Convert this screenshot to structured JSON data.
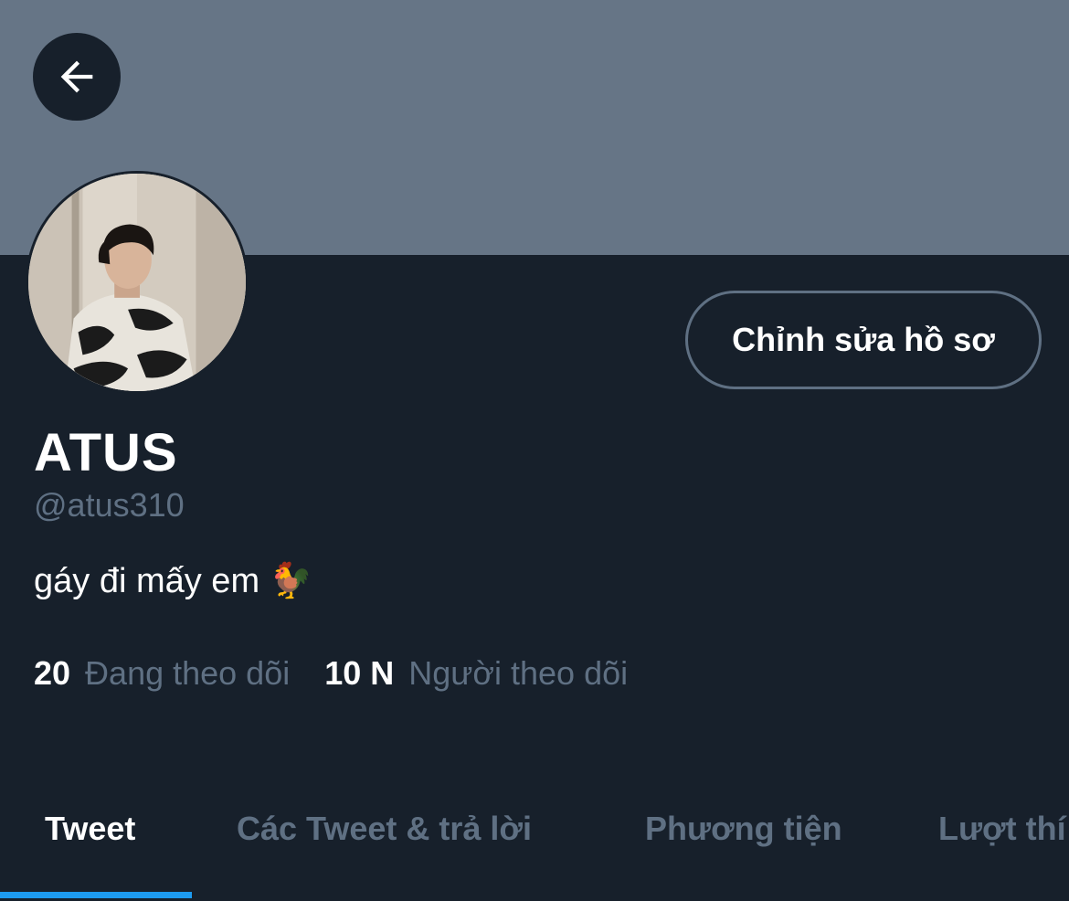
{
  "header": {
    "back_icon": "arrow-left-icon",
    "banner_color": "#667586"
  },
  "profile": {
    "name": "ATUS",
    "handle": "@atus310",
    "bio": "gáy đi mấy em 🐓",
    "edit_button_label": "Chỉnh sửa hồ sơ"
  },
  "stats": {
    "following_count": "20",
    "following_label": "Đang theo dõi",
    "followers_count": "10 N",
    "followers_label": "Người theo dõi"
  },
  "tabs": [
    {
      "label": "Tweet",
      "active": true
    },
    {
      "label": "Các Tweet & trả lời",
      "active": false
    },
    {
      "label": "Phương tiện",
      "active": false
    },
    {
      "label": "Lượt thí",
      "active": false
    }
  ],
  "colors": {
    "background": "#17202b",
    "muted_text": "#5f7083",
    "accent": "#1d9bf0"
  }
}
